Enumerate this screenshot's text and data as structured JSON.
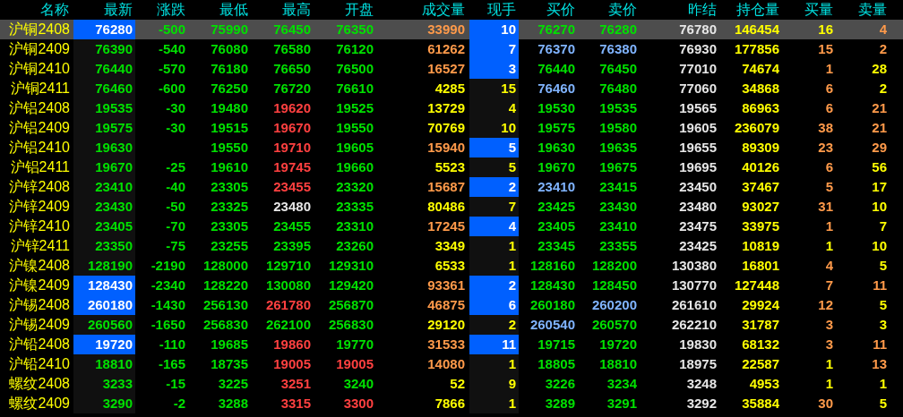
{
  "columns": [
    "名称",
    "最新",
    "涨跌",
    "最低",
    "最高",
    "开盘",
    "成交量",
    "现手",
    "买价",
    "卖价",
    "昨结",
    "持仓量",
    "买量",
    "卖量"
  ],
  "rows": [
    {
      "name": "沪铜2408",
      "selected": true,
      "latest_flash": true,
      "hand_flash": true,
      "cells": [
        {
          "text": "76280",
          "color": "#ffffff"
        },
        {
          "text": "-500",
          "color": "#00e000"
        },
        {
          "text": "75990",
          "color": "#00e000"
        },
        {
          "text": "76450",
          "color": "#00e000"
        },
        {
          "text": "76350",
          "color": "#00e000"
        },
        {
          "text": "33990",
          "color": "#ff9a4a"
        },
        {
          "text": "10",
          "color": "#ffffff"
        },
        {
          "text": "76270",
          "color": "#00e000"
        },
        {
          "text": "76280",
          "color": "#00e000"
        },
        {
          "text": "76780",
          "color": "#e6e6e6"
        },
        {
          "text": "146454",
          "color": "#ffff00"
        },
        {
          "text": "16",
          "color": "#ffff00"
        },
        {
          "text": "4",
          "color": "#ff9a4a"
        }
      ]
    },
    {
      "name": "沪铜2409",
      "selected": false,
      "latest_flash": false,
      "hand_flash": true,
      "cells": [
        {
          "text": "76390",
          "color": "#00e000"
        },
        {
          "text": "-540",
          "color": "#00e000"
        },
        {
          "text": "76080",
          "color": "#00e000"
        },
        {
          "text": "76580",
          "color": "#00e000"
        },
        {
          "text": "76120",
          "color": "#00e000"
        },
        {
          "text": "61262",
          "color": "#ff9a4a"
        },
        {
          "text": "7",
          "color": "#ffffff"
        },
        {
          "text": "76370",
          "color": "#80b4ff"
        },
        {
          "text": "76380",
          "color": "#80b4ff"
        },
        {
          "text": "76930",
          "color": "#e6e6e6"
        },
        {
          "text": "177856",
          "color": "#ffff00"
        },
        {
          "text": "15",
          "color": "#ff9a4a"
        },
        {
          "text": "2",
          "color": "#ff9a4a"
        }
      ]
    },
    {
      "name": "沪铜2410",
      "selected": false,
      "latest_flash": false,
      "hand_flash": true,
      "cells": [
        {
          "text": "76440",
          "color": "#00e000"
        },
        {
          "text": "-570",
          "color": "#00e000"
        },
        {
          "text": "76180",
          "color": "#00e000"
        },
        {
          "text": "76650",
          "color": "#00e000"
        },
        {
          "text": "76500",
          "color": "#00e000"
        },
        {
          "text": "16527",
          "color": "#ff9a4a"
        },
        {
          "text": "3",
          "color": "#ffffff"
        },
        {
          "text": "76440",
          "color": "#00e000"
        },
        {
          "text": "76450",
          "color": "#00e000"
        },
        {
          "text": "77010",
          "color": "#e6e6e6"
        },
        {
          "text": "74674",
          "color": "#ffff00"
        },
        {
          "text": "1",
          "color": "#ff9a4a"
        },
        {
          "text": "28",
          "color": "#ffff00"
        }
      ]
    },
    {
      "name": "沪铜2411",
      "selected": false,
      "latest_flash": false,
      "hand_flash": false,
      "cells": [
        {
          "text": "76460",
          "color": "#00e000"
        },
        {
          "text": "-600",
          "color": "#00e000"
        },
        {
          "text": "76250",
          "color": "#00e000"
        },
        {
          "text": "76720",
          "color": "#00e000"
        },
        {
          "text": "76610",
          "color": "#00e000"
        },
        {
          "text": "4285",
          "color": "#ffff00"
        },
        {
          "text": "15",
          "color": "#ffff00"
        },
        {
          "text": "76460",
          "color": "#80b4ff"
        },
        {
          "text": "76480",
          "color": "#00e000"
        },
        {
          "text": "77060",
          "color": "#e6e6e6"
        },
        {
          "text": "34868",
          "color": "#ffff00"
        },
        {
          "text": "6",
          "color": "#ff9a4a"
        },
        {
          "text": "2",
          "color": "#ffff00"
        }
      ]
    },
    {
      "name": "沪铝2408",
      "selected": false,
      "latest_flash": false,
      "hand_flash": false,
      "cells": [
        {
          "text": "19535",
          "color": "#00e000"
        },
        {
          "text": "-30",
          "color": "#00e000"
        },
        {
          "text": "19480",
          "color": "#00e000"
        },
        {
          "text": "19620",
          "color": "#ff4040"
        },
        {
          "text": "19525",
          "color": "#00e000"
        },
        {
          "text": "13729",
          "color": "#ffff00"
        },
        {
          "text": "4",
          "color": "#ffff00"
        },
        {
          "text": "19530",
          "color": "#00e000"
        },
        {
          "text": "19535",
          "color": "#00e000"
        },
        {
          "text": "19565",
          "color": "#e6e6e6"
        },
        {
          "text": "86963",
          "color": "#ffff00"
        },
        {
          "text": "6",
          "color": "#ff9a4a"
        },
        {
          "text": "21",
          "color": "#ff9a4a"
        }
      ]
    },
    {
      "name": "沪铝2409",
      "selected": false,
      "latest_flash": false,
      "hand_flash": false,
      "cells": [
        {
          "text": "19575",
          "color": "#00e000"
        },
        {
          "text": "-30",
          "color": "#00e000"
        },
        {
          "text": "19515",
          "color": "#00e000"
        },
        {
          "text": "19670",
          "color": "#ff4040"
        },
        {
          "text": "19550",
          "color": "#00e000"
        },
        {
          "text": "70769",
          "color": "#ffff00"
        },
        {
          "text": "10",
          "color": "#ffff00"
        },
        {
          "text": "19575",
          "color": "#00e000"
        },
        {
          "text": "19580",
          "color": "#00e000"
        },
        {
          "text": "19605",
          "color": "#e6e6e6"
        },
        {
          "text": "236079",
          "color": "#ffff00"
        },
        {
          "text": "38",
          "color": "#ff9a4a"
        },
        {
          "text": "21",
          "color": "#ff9a4a"
        }
      ]
    },
    {
      "name": "沪铝2410",
      "selected": false,
      "latest_flash": false,
      "hand_flash": true,
      "cells": [
        {
          "text": "19630",
          "color": "#00e000"
        },
        null,
        {
          "text": "19550",
          "color": "#00e000"
        },
        {
          "text": "19710",
          "color": "#ff4040"
        },
        {
          "text": "19605",
          "color": "#00e000"
        },
        {
          "text": "15940",
          "color": "#ff9a4a"
        },
        {
          "text": "5",
          "color": "#ffffff"
        },
        {
          "text": "19630",
          "color": "#00e000"
        },
        {
          "text": "19635",
          "color": "#00e000"
        },
        {
          "text": "19655",
          "color": "#e6e6e6"
        },
        {
          "text": "89309",
          "color": "#ffff00"
        },
        {
          "text": "23",
          "color": "#ff9a4a"
        },
        {
          "text": "29",
          "color": "#ff9a4a"
        }
      ]
    },
    {
      "name": "沪铝2411",
      "selected": false,
      "latest_flash": false,
      "hand_flash": false,
      "cells": [
        {
          "text": "19670",
          "color": "#00e000"
        },
        {
          "text": "-25",
          "color": "#00e000"
        },
        {
          "text": "19610",
          "color": "#00e000"
        },
        {
          "text": "19745",
          "color": "#ff4040"
        },
        {
          "text": "19660",
          "color": "#00e000"
        },
        {
          "text": "5523",
          "color": "#ffff00"
        },
        {
          "text": "5",
          "color": "#ffff00"
        },
        {
          "text": "19670",
          "color": "#00e000"
        },
        {
          "text": "19675",
          "color": "#00e000"
        },
        {
          "text": "19695",
          "color": "#e6e6e6"
        },
        {
          "text": "40126",
          "color": "#ffff00"
        },
        {
          "text": "6",
          "color": "#ff9a4a"
        },
        {
          "text": "56",
          "color": "#ffff00"
        }
      ]
    },
    {
      "name": "沪锌2408",
      "selected": false,
      "latest_flash": false,
      "hand_flash": true,
      "cells": [
        {
          "text": "23410",
          "color": "#00e000"
        },
        {
          "text": "-40",
          "color": "#00e000"
        },
        {
          "text": "23305",
          "color": "#00e000"
        },
        {
          "text": "23455",
          "color": "#ff4040"
        },
        {
          "text": "23320",
          "color": "#00e000"
        },
        {
          "text": "15687",
          "color": "#ff9a4a"
        },
        {
          "text": "2",
          "color": "#ffffff"
        },
        {
          "text": "23410",
          "color": "#80b4ff"
        },
        {
          "text": "23415",
          "color": "#00e000"
        },
        {
          "text": "23450",
          "color": "#e6e6e6"
        },
        {
          "text": "37467",
          "color": "#ffff00"
        },
        {
          "text": "5",
          "color": "#ff9a4a"
        },
        {
          "text": "17",
          "color": "#ffff00"
        }
      ]
    },
    {
      "name": "沪锌2409",
      "selected": false,
      "latest_flash": false,
      "hand_flash": false,
      "cells": [
        {
          "text": "23430",
          "color": "#00e000"
        },
        {
          "text": "-50",
          "color": "#00e000"
        },
        {
          "text": "23325",
          "color": "#00e000"
        },
        {
          "text": "23480",
          "color": "#e6e6e6"
        },
        {
          "text": "23335",
          "color": "#00e000"
        },
        {
          "text": "80486",
          "color": "#ffff00"
        },
        {
          "text": "7",
          "color": "#ffff00"
        },
        {
          "text": "23425",
          "color": "#00e000"
        },
        {
          "text": "23430",
          "color": "#00e000"
        },
        {
          "text": "23480",
          "color": "#e6e6e6"
        },
        {
          "text": "93027",
          "color": "#ffff00"
        },
        {
          "text": "31",
          "color": "#ff9a4a"
        },
        {
          "text": "10",
          "color": "#ffff00"
        }
      ]
    },
    {
      "name": "沪锌2410",
      "selected": false,
      "latest_flash": false,
      "hand_flash": true,
      "cells": [
        {
          "text": "23405",
          "color": "#00e000"
        },
        {
          "text": "-70",
          "color": "#00e000"
        },
        {
          "text": "23305",
          "color": "#00e000"
        },
        {
          "text": "23455",
          "color": "#00e000"
        },
        {
          "text": "23310",
          "color": "#00e000"
        },
        {
          "text": "17245",
          "color": "#ff9a4a"
        },
        {
          "text": "4",
          "color": "#ffffff"
        },
        {
          "text": "23405",
          "color": "#00e000"
        },
        {
          "text": "23410",
          "color": "#00e000"
        },
        {
          "text": "23475",
          "color": "#e6e6e6"
        },
        {
          "text": "33975",
          "color": "#ffff00"
        },
        {
          "text": "1",
          "color": "#ff9a4a"
        },
        {
          "text": "7",
          "color": "#ffff00"
        }
      ]
    },
    {
      "name": "沪锌2411",
      "selected": false,
      "latest_flash": false,
      "hand_flash": false,
      "cells": [
        {
          "text": "23350",
          "color": "#00e000"
        },
        {
          "text": "-75",
          "color": "#00e000"
        },
        {
          "text": "23255",
          "color": "#00e000"
        },
        {
          "text": "23395",
          "color": "#00e000"
        },
        {
          "text": "23260",
          "color": "#00e000"
        },
        {
          "text": "3349",
          "color": "#ffff00"
        },
        {
          "text": "1",
          "color": "#ffff00"
        },
        {
          "text": "23345",
          "color": "#00e000"
        },
        {
          "text": "23355",
          "color": "#00e000"
        },
        {
          "text": "23425",
          "color": "#e6e6e6"
        },
        {
          "text": "10819",
          "color": "#ffff00"
        },
        {
          "text": "1",
          "color": "#ffff00"
        },
        {
          "text": "10",
          "color": "#ffff00"
        }
      ]
    },
    {
      "name": "沪镍2408",
      "selected": false,
      "latest_flash": false,
      "hand_flash": false,
      "cells": [
        {
          "text": "128190",
          "color": "#00e000"
        },
        {
          "text": "-2190",
          "color": "#00e000"
        },
        {
          "text": "128000",
          "color": "#00e000"
        },
        {
          "text": "129710",
          "color": "#00e000"
        },
        {
          "text": "129310",
          "color": "#00e000"
        },
        {
          "text": "6533",
          "color": "#ffff00"
        },
        {
          "text": "1",
          "color": "#ffff00"
        },
        {
          "text": "128160",
          "color": "#00e000"
        },
        {
          "text": "128200",
          "color": "#00e000"
        },
        {
          "text": "130380",
          "color": "#e6e6e6"
        },
        {
          "text": "16801",
          "color": "#ffff00"
        },
        {
          "text": "4",
          "color": "#ff9a4a"
        },
        {
          "text": "5",
          "color": "#ffff00"
        }
      ]
    },
    {
      "name": "沪镍2409",
      "selected": false,
      "latest_flash": true,
      "hand_flash": true,
      "cells": [
        {
          "text": "128430",
          "color": "#ffffff"
        },
        {
          "text": "-2340",
          "color": "#00e000"
        },
        {
          "text": "128220",
          "color": "#00e000"
        },
        {
          "text": "130080",
          "color": "#00e000"
        },
        {
          "text": "129420",
          "color": "#00e000"
        },
        {
          "text": "93361",
          "color": "#ff9a4a"
        },
        {
          "text": "2",
          "color": "#ffffff"
        },
        {
          "text": "128430",
          "color": "#00e000"
        },
        {
          "text": "128450",
          "color": "#00e000"
        },
        {
          "text": "130770",
          "color": "#e6e6e6"
        },
        {
          "text": "127448",
          "color": "#ffff00"
        },
        {
          "text": "7",
          "color": "#ff9a4a"
        },
        {
          "text": "11",
          "color": "#ff9a4a"
        }
      ]
    },
    {
      "name": "沪锡2408",
      "selected": false,
      "latest_flash": true,
      "hand_flash": true,
      "cells": [
        {
          "text": "260180",
          "color": "#ffffff"
        },
        {
          "text": "-1430",
          "color": "#00e000"
        },
        {
          "text": "256130",
          "color": "#00e000"
        },
        {
          "text": "261780",
          "color": "#ff4040"
        },
        {
          "text": "256870",
          "color": "#00e000"
        },
        {
          "text": "46875",
          "color": "#ff9a4a"
        },
        {
          "text": "6",
          "color": "#ffffff"
        },
        {
          "text": "260180",
          "color": "#00e000"
        },
        {
          "text": "260200",
          "color": "#80b4ff"
        },
        {
          "text": "261610",
          "color": "#e6e6e6"
        },
        {
          "text": "29924",
          "color": "#ffff00"
        },
        {
          "text": "12",
          "color": "#ff9a4a"
        },
        {
          "text": "5",
          "color": "#ffff00"
        }
      ]
    },
    {
      "name": "沪锡2409",
      "selected": false,
      "latest_flash": false,
      "hand_flash": false,
      "cells": [
        {
          "text": "260560",
          "color": "#00e000"
        },
        {
          "text": "-1650",
          "color": "#00e000"
        },
        {
          "text": "256830",
          "color": "#00e000"
        },
        {
          "text": "262100",
          "color": "#00e000"
        },
        {
          "text": "256830",
          "color": "#00e000"
        },
        {
          "text": "29120",
          "color": "#ffff00"
        },
        {
          "text": "2",
          "color": "#ffff00"
        },
        {
          "text": "260540",
          "color": "#80b4ff"
        },
        {
          "text": "260570",
          "color": "#00e000"
        },
        {
          "text": "262210",
          "color": "#e6e6e6"
        },
        {
          "text": "31787",
          "color": "#ffff00"
        },
        {
          "text": "3",
          "color": "#ff9a4a"
        },
        {
          "text": "3",
          "color": "#ffff00"
        }
      ]
    },
    {
      "name": "沪铅2408",
      "selected": false,
      "latest_flash": true,
      "hand_flash": true,
      "cells": [
        {
          "text": "19720",
          "color": "#ffffff"
        },
        {
          "text": "-110",
          "color": "#00e000"
        },
        {
          "text": "19685",
          "color": "#00e000"
        },
        {
          "text": "19860",
          "color": "#ff4040"
        },
        {
          "text": "19770",
          "color": "#00e000"
        },
        {
          "text": "31533",
          "color": "#ff9a4a"
        },
        {
          "text": "11",
          "color": "#ffffff"
        },
        {
          "text": "19715",
          "color": "#00e000"
        },
        {
          "text": "19720",
          "color": "#00e000"
        },
        {
          "text": "19830",
          "color": "#e6e6e6"
        },
        {
          "text": "68132",
          "color": "#ffff00"
        },
        {
          "text": "3",
          "color": "#ff9a4a"
        },
        {
          "text": "11",
          "color": "#ff9a4a"
        }
      ]
    },
    {
      "name": "沪铅2410",
      "selected": false,
      "latest_flash": false,
      "hand_flash": false,
      "cells": [
        {
          "text": "18810",
          "color": "#00e000"
        },
        {
          "text": "-165",
          "color": "#00e000"
        },
        {
          "text": "18735",
          "color": "#00e000"
        },
        {
          "text": "19005",
          "color": "#ff4040"
        },
        {
          "text": "19005",
          "color": "#ff4040"
        },
        {
          "text": "14080",
          "color": "#ff9a4a"
        },
        {
          "text": "1",
          "color": "#ffff00"
        },
        {
          "text": "18805",
          "color": "#00e000"
        },
        {
          "text": "18810",
          "color": "#00e000"
        },
        {
          "text": "18975",
          "color": "#e6e6e6"
        },
        {
          "text": "22587",
          "color": "#ffff00"
        },
        {
          "text": "1",
          "color": "#ffff00"
        },
        {
          "text": "13",
          "color": "#ff9a4a"
        }
      ]
    },
    {
      "name": "螺纹2408",
      "selected": false,
      "latest_flash": false,
      "hand_flash": false,
      "cells": [
        {
          "text": "3233",
          "color": "#00e000"
        },
        {
          "text": "-15",
          "color": "#00e000"
        },
        {
          "text": "3225",
          "color": "#00e000"
        },
        {
          "text": "3251",
          "color": "#ff4040"
        },
        {
          "text": "3240",
          "color": "#00e000"
        },
        {
          "text": "52",
          "color": "#ffff00"
        },
        {
          "text": "9",
          "color": "#ffff00"
        },
        {
          "text": "3226",
          "color": "#00e000"
        },
        {
          "text": "3234",
          "color": "#00e000"
        },
        {
          "text": "3248",
          "color": "#e6e6e6"
        },
        {
          "text": "4953",
          "color": "#ffff00"
        },
        {
          "text": "1",
          "color": "#ffff00"
        },
        {
          "text": "1",
          "color": "#ffff00"
        }
      ]
    },
    {
      "name": "螺纹2409",
      "selected": false,
      "latest_flash": false,
      "hand_flash": false,
      "cells": [
        {
          "text": "3290",
          "color": "#00e000"
        },
        {
          "text": "-2",
          "color": "#00e000"
        },
        {
          "text": "3288",
          "color": "#00e000"
        },
        {
          "text": "3315",
          "color": "#ff4040"
        },
        {
          "text": "3300",
          "color": "#ff4040"
        },
        {
          "text": "7866",
          "color": "#ffff00"
        },
        {
          "text": "1",
          "color": "#ffff00"
        },
        {
          "text": "3289",
          "color": "#00e000"
        },
        {
          "text": "3291",
          "color": "#00e000"
        },
        {
          "text": "3292",
          "color": "#e6e6e6"
        },
        {
          "text": "35884",
          "color": "#ffff00"
        },
        {
          "text": "30",
          "color": "#ff9a4a"
        },
        {
          "text": "5",
          "color": "#ffff00"
        }
      ]
    }
  ]
}
